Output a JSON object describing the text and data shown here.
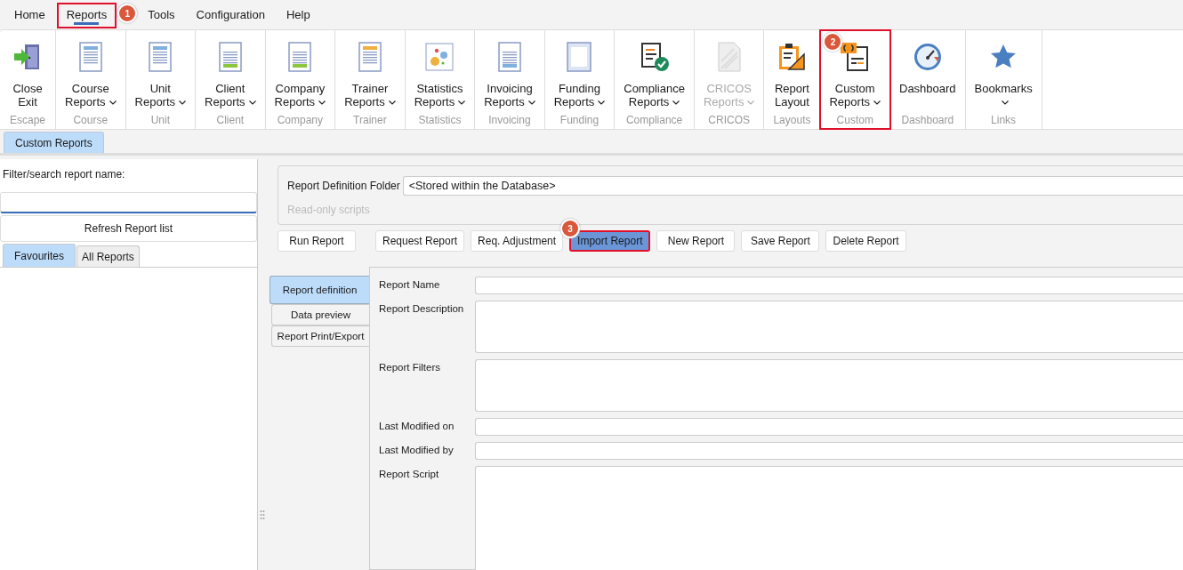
{
  "menu": [
    {
      "label": "Home",
      "selected": false,
      "highlighted": false
    },
    {
      "label": "Reports",
      "selected": true,
      "highlighted": true,
      "callout": "1"
    },
    {
      "label": "Tools",
      "selected": false,
      "highlighted": false
    },
    {
      "label": "Configuration",
      "selected": false,
      "highlighted": false
    },
    {
      "label": "Help",
      "selected": false,
      "highlighted": false
    }
  ],
  "ribbon": [
    {
      "kind": "exit",
      "lines": [
        "Close",
        "Exit"
      ],
      "dropdown": false,
      "disabled": false,
      "highlighted": false,
      "group": "Escape"
    },
    {
      "kind": "doc-blue",
      "lines": [
        "Course",
        "Reports"
      ],
      "dropdown": true,
      "disabled": false,
      "highlighted": false,
      "group": "Course"
    },
    {
      "kind": "doc-blue",
      "lines": [
        "Unit",
        "Reports"
      ],
      "dropdown": true,
      "disabled": false,
      "highlighted": false,
      "group": "Unit"
    },
    {
      "kind": "doc-green",
      "lines": [
        "Client",
        "Reports"
      ],
      "dropdown": true,
      "disabled": false,
      "highlighted": false,
      "group": "Client"
    },
    {
      "kind": "doc-green",
      "lines": [
        "Company",
        "Reports"
      ],
      "dropdown": true,
      "disabled": false,
      "highlighted": false,
      "group": "Company"
    },
    {
      "kind": "doc-orange",
      "lines": [
        "Trainer",
        "Reports"
      ],
      "dropdown": true,
      "disabled": false,
      "highlighted": false,
      "group": "Trainer"
    },
    {
      "kind": "stats",
      "lines": [
        "Statistics",
        "Reports"
      ],
      "dropdown": true,
      "disabled": false,
      "highlighted": false,
      "group": "Statistics"
    },
    {
      "kind": "doc-bottom",
      "lines": [
        "Invoicing",
        "Reports"
      ],
      "dropdown": true,
      "disabled": false,
      "highlighted": false,
      "group": "Invoicing"
    },
    {
      "kind": "frame",
      "lines": [
        "Funding",
        "Reports"
      ],
      "dropdown": true,
      "disabled": false,
      "highlighted": false,
      "group": "Funding"
    },
    {
      "kind": "compliance",
      "lines": [
        "Compliance",
        "Reports"
      ],
      "dropdown": true,
      "disabled": false,
      "highlighted": false,
      "group": "Compliance"
    },
    {
      "kind": "cricos",
      "lines": [
        "CRICOS",
        "Reports"
      ],
      "dropdown": true,
      "disabled": true,
      "highlighted": false,
      "group": "CRICOS"
    },
    {
      "kind": "layout",
      "lines": [
        "Report",
        "Layout"
      ],
      "dropdown": false,
      "disabled": false,
      "highlighted": false,
      "group": "Layouts"
    },
    {
      "kind": "custom",
      "lines": [
        "Custom",
        "Reports"
      ],
      "dropdown": true,
      "disabled": false,
      "highlighted": true,
      "callout": "2",
      "group": "Custom"
    },
    {
      "kind": "gauge",
      "lines": [
        "Dashboard"
      ],
      "dropdown": false,
      "disabled": false,
      "highlighted": false,
      "group": "Dashboard"
    },
    {
      "kind": "star",
      "lines": [
        "Bookmarks"
      ],
      "dropdown": true,
      "disabled": false,
      "highlighted": false,
      "group": "Links"
    }
  ],
  "doc_tabs": [
    {
      "label": "Custom Reports",
      "selected": true
    }
  ],
  "left_panel": {
    "filter_label": "Filter/search report name:",
    "refresh_button": "Refresh Report list",
    "tabs": [
      {
        "label": "Favourites",
        "selected": true
      },
      {
        "label": "All Reports",
        "selected": false
      }
    ]
  },
  "folder": {
    "label": "Report Definition Folder",
    "value": "<Stored within the Database>",
    "note": "Read-only scripts"
  },
  "actions": [
    {
      "label": "Run Report",
      "highlighted": false
    },
    {
      "label": "Request Report",
      "highlighted": false
    },
    {
      "label": "Req. Adjustment",
      "highlighted": false
    },
    {
      "label": "Import Report",
      "highlighted": true,
      "callout": "3"
    },
    {
      "label": "New Report",
      "highlighted": false
    },
    {
      "label": "Save Report",
      "highlighted": false
    },
    {
      "label": "Delete Report",
      "highlighted": false
    }
  ],
  "side_tabs": [
    {
      "label": "Report definition",
      "selected": true
    },
    {
      "label": "Data preview",
      "selected": false
    },
    {
      "label": "Report Print/Export",
      "selected": false
    }
  ],
  "fields": [
    {
      "label": "Report Name",
      "kind": "line"
    },
    {
      "label": "Report Description",
      "kind": "area"
    },
    {
      "label": "Report Filters",
      "kind": "area"
    },
    {
      "label": "Last Modified on",
      "kind": "line"
    },
    {
      "label": "Last Modified by",
      "kind": "line"
    },
    {
      "label": "Report Script",
      "kind": "script"
    }
  ]
}
